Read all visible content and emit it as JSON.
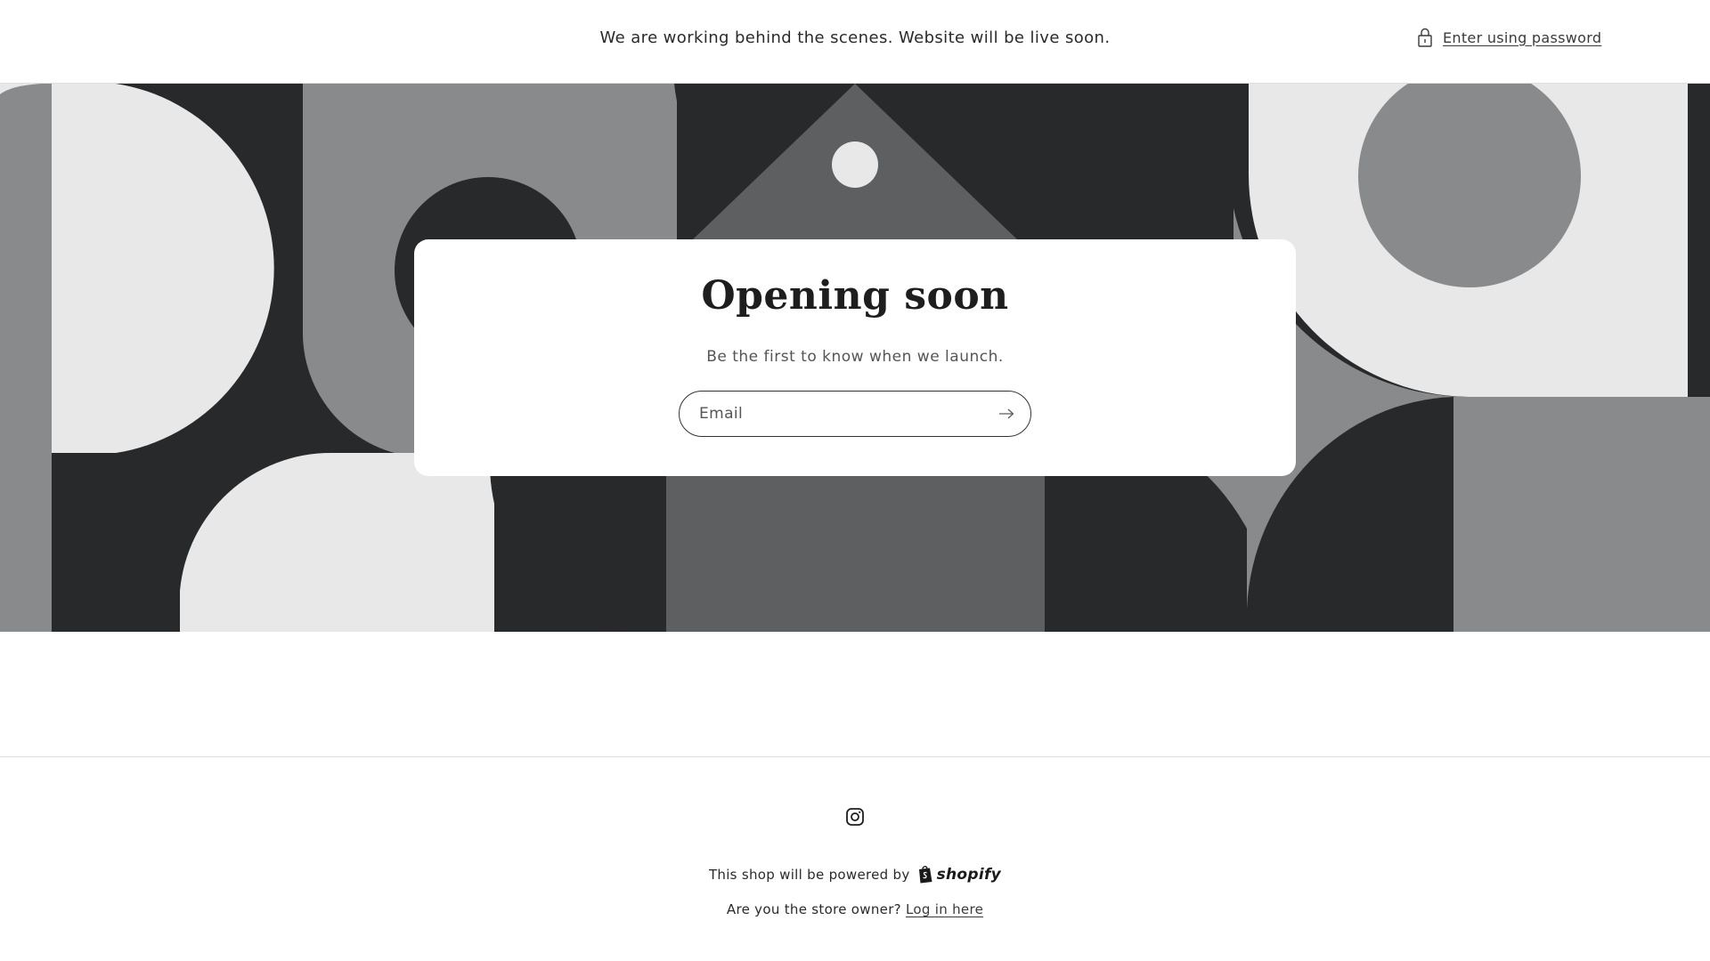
{
  "header": {
    "message": "We are working behind the scenes. Website will be live soon.",
    "password_link": "Enter using password",
    "lock_icon": "lock-icon"
  },
  "banner": {
    "colors": {
      "dark": "#28292b",
      "mid": "#898a8c",
      "slate": "#5e5f61",
      "light": "#e8e8e8"
    }
  },
  "card": {
    "title": "Opening soon",
    "subtitle": "Be the first to know when we launch.",
    "email_placeholder": "Email",
    "submit_icon": "arrow-right-icon"
  },
  "footer": {
    "social_icon": "instagram-icon",
    "powered_text": "This shop will be powered by",
    "shopify_label": "shopify",
    "owner_text": "Are you the store owner?",
    "login_link": "Log in here"
  }
}
